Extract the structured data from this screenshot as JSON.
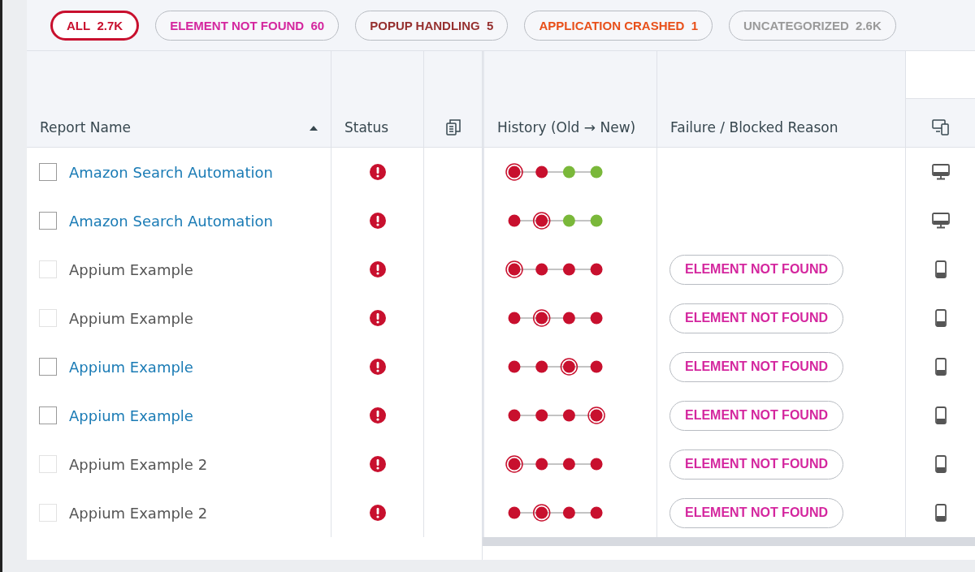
{
  "filters": [
    {
      "label": "ALL",
      "count": "2.7K",
      "color": "#c8102e",
      "selected": true
    },
    {
      "label": "ELEMENT NOT FOUND",
      "count": "60",
      "color": "#d4269e",
      "selected": false
    },
    {
      "label": "POPUP HANDLING",
      "count": "5",
      "color": "#96302f",
      "selected": false
    },
    {
      "label": "APPLICATION CRASHED",
      "count": "1",
      "color": "#e8501a",
      "selected": false
    },
    {
      "label": "UNCATEGORIZED",
      "count": "2.6K",
      "color": "#9a9a9a",
      "selected": false
    }
  ],
  "table": {
    "columns": [
      {
        "label": "Report Name",
        "sorted": true
      },
      {
        "label": "Status"
      },
      {
        "label": "History (Old → New)"
      },
      {
        "label": "Failure / Blocked Reason"
      }
    ],
    "rows": [
      {
        "name": "Amazon Search Automation",
        "disabled": false,
        "checked": false,
        "kind": "desktop",
        "reason": null,
        "history": [
          {
            "color": "#c8102e",
            "selected": true
          },
          {
            "color": "#c8102e",
            "selected": false
          },
          {
            "color": "#7ab83a",
            "selected": false
          },
          {
            "color": "#7ab83a",
            "selected": false
          }
        ]
      },
      {
        "name": "Amazon Search Automation",
        "disabled": false,
        "checked": false,
        "kind": "desktop",
        "reason": null,
        "history": [
          {
            "color": "#c8102e",
            "selected": false
          },
          {
            "color": "#c8102e",
            "selected": true
          },
          {
            "color": "#7ab83a",
            "selected": false
          },
          {
            "color": "#7ab83a",
            "selected": false
          }
        ]
      },
      {
        "name": "Appium Example",
        "disabled": true,
        "checked": false,
        "kind": "mobile",
        "reason": "ELEMENT NOT FOUND",
        "history": [
          {
            "color": "#c8102e",
            "selected": true
          },
          {
            "color": "#c8102e",
            "selected": false
          },
          {
            "color": "#c8102e",
            "selected": false
          },
          {
            "color": "#c8102e",
            "selected": false
          }
        ]
      },
      {
        "name": "Appium Example",
        "disabled": true,
        "checked": false,
        "kind": "mobile",
        "reason": "ELEMENT NOT FOUND",
        "history": [
          {
            "color": "#c8102e",
            "selected": false
          },
          {
            "color": "#c8102e",
            "selected": true
          },
          {
            "color": "#c8102e",
            "selected": false
          },
          {
            "color": "#c8102e",
            "selected": false
          }
        ]
      },
      {
        "name": "Appium Example",
        "disabled": false,
        "checked": false,
        "kind": "mobile",
        "reason": "ELEMENT NOT FOUND",
        "history": [
          {
            "color": "#c8102e",
            "selected": false
          },
          {
            "color": "#c8102e",
            "selected": false
          },
          {
            "color": "#c8102e",
            "selected": true
          },
          {
            "color": "#c8102e",
            "selected": false
          }
        ]
      },
      {
        "name": "Appium Example",
        "disabled": false,
        "checked": false,
        "kind": "mobile",
        "reason": "ELEMENT NOT FOUND",
        "history": [
          {
            "color": "#c8102e",
            "selected": false
          },
          {
            "color": "#c8102e",
            "selected": false
          },
          {
            "color": "#c8102e",
            "selected": false
          },
          {
            "color": "#c8102e",
            "selected": true
          }
        ]
      },
      {
        "name": "Appium Example 2",
        "disabled": true,
        "checked": false,
        "kind": "mobile",
        "reason": "ELEMENT NOT FOUND",
        "history": [
          {
            "color": "#c8102e",
            "selected": true
          },
          {
            "color": "#c8102e",
            "selected": false
          },
          {
            "color": "#c8102e",
            "selected": false
          },
          {
            "color": "#c8102e",
            "selected": false
          }
        ]
      },
      {
        "name": "Appium Example 2",
        "disabled": true,
        "checked": false,
        "kind": "mobile",
        "reason": "ELEMENT NOT FOUND",
        "history": [
          {
            "color": "#c8102e",
            "selected": false
          },
          {
            "color": "#c8102e",
            "selected": true
          },
          {
            "color": "#c8102e",
            "selected": false
          },
          {
            "color": "#c8102e",
            "selected": false
          }
        ]
      }
    ]
  }
}
